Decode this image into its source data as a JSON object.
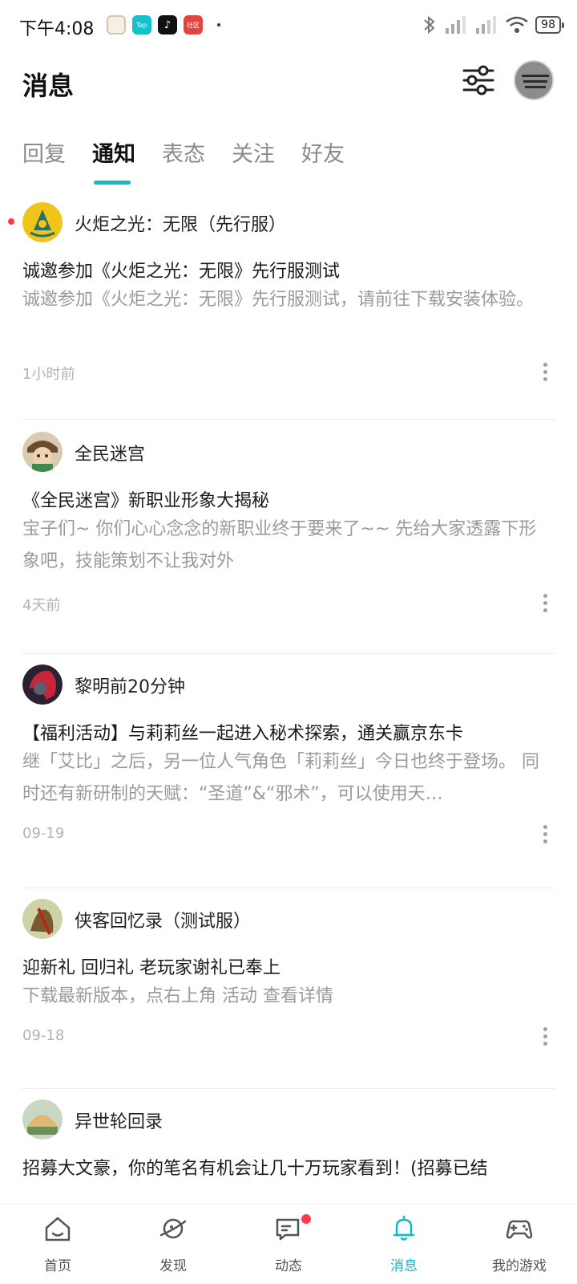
{
  "status_bar": {
    "time": "下午4:08",
    "apps": [
      "Tap",
      "♪",
      "社区"
    ],
    "battery": "98"
  },
  "header": {
    "title": "消息",
    "filter_icon": "sliders-icon",
    "avatar_icon": "user-avatar"
  },
  "tabs": [
    {
      "label": "回复",
      "active": false
    },
    {
      "label": "通知",
      "active": true
    },
    {
      "label": "表态",
      "active": false
    },
    {
      "label": "关注",
      "active": false
    },
    {
      "label": "好友",
      "active": false
    }
  ],
  "notifications": [
    {
      "sender": "火炬之光：无限（先行服）",
      "title": "诚邀参加《火炬之光：无限》先行服测试",
      "body": "诚邀参加《火炬之光：无限》先行服测试，请前往下载安装体验。",
      "time": "1小时前",
      "unread": true
    },
    {
      "sender": "全民迷宫",
      "title": "《全民迷宫》新职业形象大揭秘",
      "body": "宝子们~ 你们心心念念的新职业终于要来了~~ 先给大家透露下形象吧，技能策划不让我对外",
      "time": "4天前",
      "unread": false
    },
    {
      "sender": "黎明前20分钟",
      "title": "【福利活动】与莉莉丝一起进入秘术探索，通关赢京东卡",
      "body": "继「艾比」之后，另一位人气角色「莉莉丝」今日也终于登场。 同时还有新研制的天赋：“圣道”&“邪术”，可以使用天…",
      "time": "09-19",
      "unread": false
    },
    {
      "sender": "侠客回忆录（测试服）",
      "title": "迎新礼 回归礼 老玩家谢礼已奉上",
      "body": "下载最新版本，点右上角 活动 查看详情",
      "time": "09-18",
      "unread": false
    },
    {
      "sender": "异世轮回录",
      "title": "招募大文豪，你的笔名有机会让几十万玩家看到！(招募已结",
      "body": "",
      "time": "",
      "unread": false
    }
  ],
  "bottom_nav": [
    {
      "label": "首页",
      "icon": "home-icon",
      "active": false
    },
    {
      "label": "发现",
      "icon": "planet-icon",
      "active": false
    },
    {
      "label": "动态",
      "icon": "chat-icon",
      "active": false,
      "badge": true
    },
    {
      "label": "消息",
      "icon": "bell-icon",
      "active": true
    },
    {
      "label": "我的游戏",
      "icon": "gamepad-icon",
      "active": false
    }
  ],
  "colors": {
    "accent": "#14b9c8",
    "badge": "#ff3b4a"
  }
}
